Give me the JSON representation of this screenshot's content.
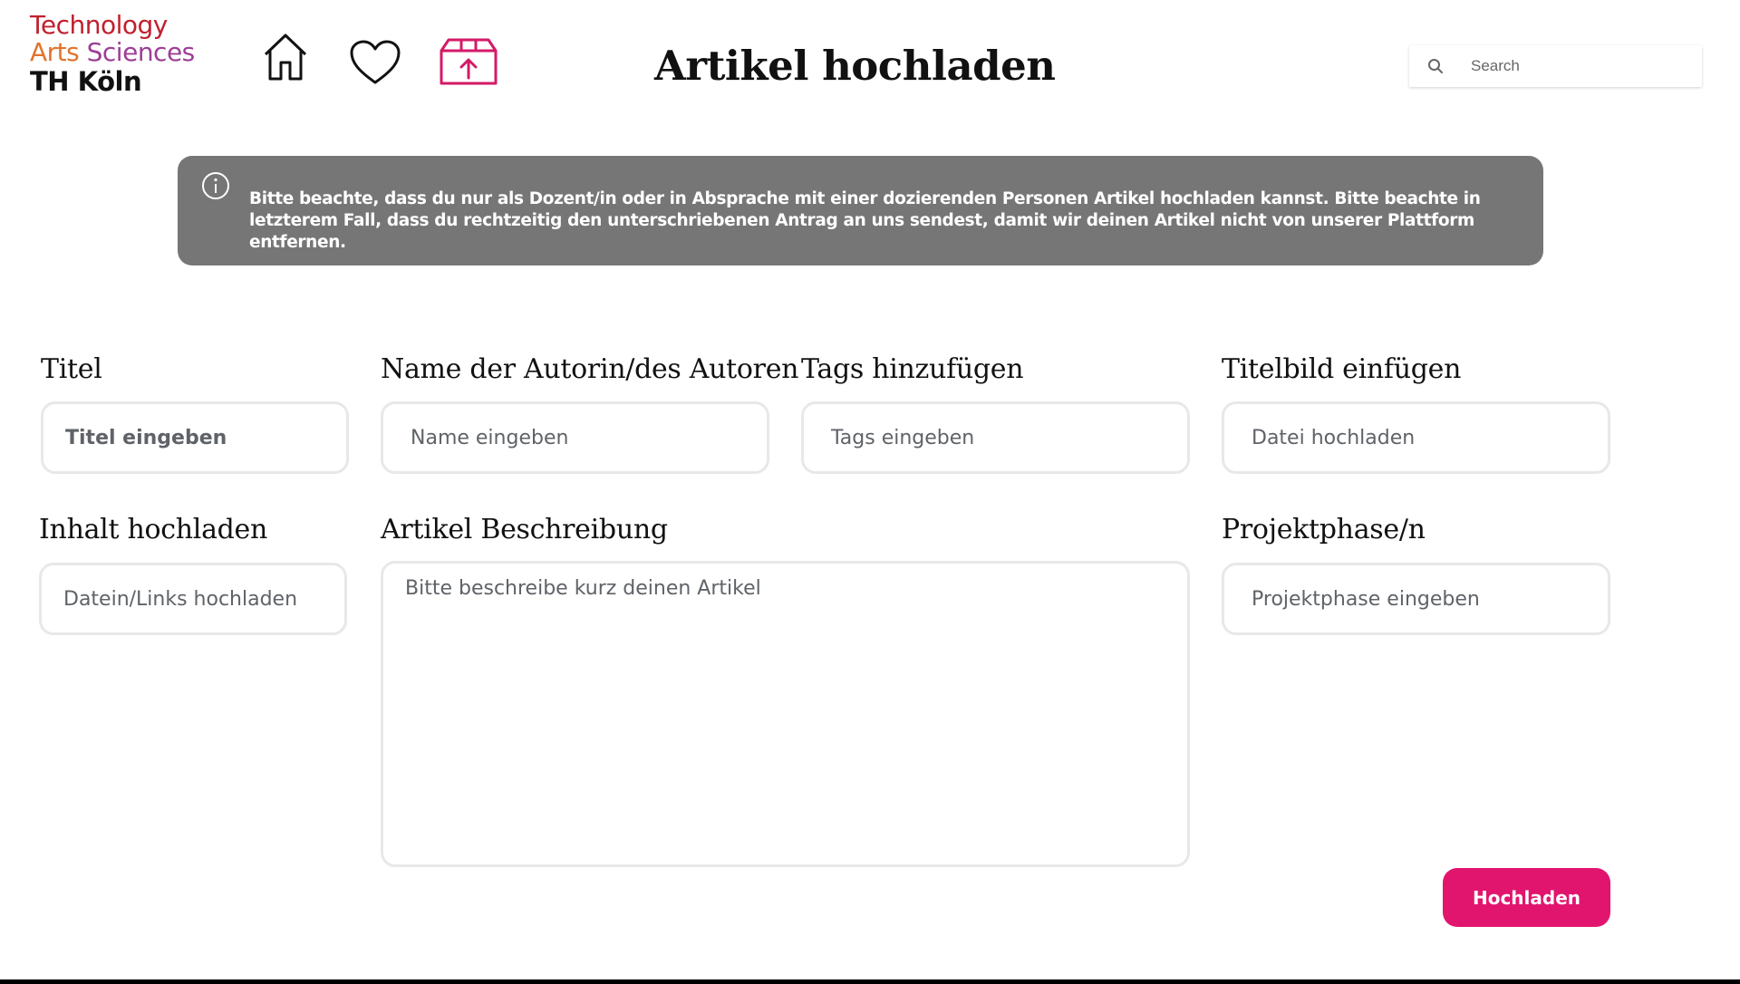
{
  "logo": {
    "line1": "Technology",
    "line2_a": "Arts",
    "line2_b": "Sciences",
    "line3": "TH Köln",
    "colors": {
      "technology": "#c0202e",
      "arts": "#e1732b",
      "sciences": "#9d3e95"
    }
  },
  "nav": {
    "home_icon": "home-icon",
    "favorites_icon": "heart-icon",
    "upload_icon": "upload-box-icon",
    "active_color": "#d41a67"
  },
  "header": {
    "title": "Artikel hochladen"
  },
  "search": {
    "placeholder": "Search",
    "icon": "search-icon"
  },
  "notice": {
    "icon": "info-icon",
    "text": "Bitte beachte, dass du nur als Dozent/in oder in Absprache mit einer dozierenden Personen Artikel hochladen kannst. Bitte beachte in letzterem Fall, dass du rechtzeitig den unterschriebenen Antrag an uns sendest, damit wir deinen Artikel nicht von unserer Plattform entfernen.",
    "background": "#767676"
  },
  "form": {
    "titel": {
      "label": "Titel",
      "placeholder": "Titel eingeben"
    },
    "author": {
      "label": "Name der Autorin/des Autoren",
      "placeholder": "Name eingeben"
    },
    "tags": {
      "label": "Tags hinzufügen",
      "placeholder": "Tags eingeben"
    },
    "cover": {
      "label": "Titelbild einfügen",
      "placeholder": "Datei hochladen"
    },
    "content": {
      "label": "Inhalt hochladen",
      "placeholder": "Datein/Links hochladen"
    },
    "description": {
      "label": "Artikel Beschreibung",
      "placeholder": "Bitte beschreibe kurz deinen Artikel"
    },
    "phase": {
      "label": "Projektphase/n",
      "placeholder": "Projektphase eingeben"
    },
    "submit_label": "Hochladen",
    "accent": "#e2156e"
  }
}
